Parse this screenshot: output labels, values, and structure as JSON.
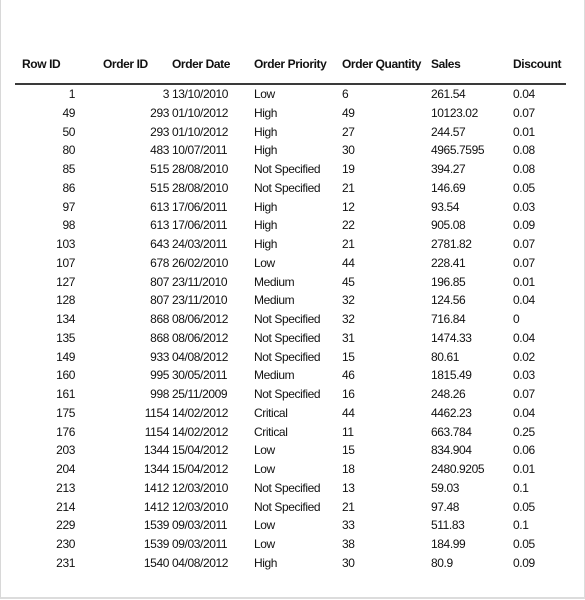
{
  "table": {
    "headers": {
      "row_id": "Row ID",
      "order_id": "Order ID",
      "order_date": "Order Date",
      "order_priority": "Order Priority",
      "order_quantity": "Order Quantity",
      "sales": "Sales",
      "discount": "Discount"
    },
    "rows": [
      {
        "row_id": "1",
        "order_id": "3",
        "order_date": "13/10/2010",
        "order_priority": "Low",
        "order_quantity": "6",
        "sales": "261.54",
        "discount": "0.04"
      },
      {
        "row_id": "49",
        "order_id": "293",
        "order_date": "01/10/2012",
        "order_priority": "High",
        "order_quantity": "49",
        "sales": "10123.02",
        "discount": "0.07"
      },
      {
        "row_id": "50",
        "order_id": "293",
        "order_date": "01/10/2012",
        "order_priority": "High",
        "order_quantity": "27",
        "sales": "244.57",
        "discount": "0.01"
      },
      {
        "row_id": "80",
        "order_id": "483",
        "order_date": "10/07/2011",
        "order_priority": "High",
        "order_quantity": "30",
        "sales": "4965.7595",
        "discount": "0.08"
      },
      {
        "row_id": "85",
        "order_id": "515",
        "order_date": "28/08/2010",
        "order_priority": "Not Specified",
        "order_quantity": "19",
        "sales": "394.27",
        "discount": "0.08"
      },
      {
        "row_id": "86",
        "order_id": "515",
        "order_date": "28/08/2010",
        "order_priority": "Not Specified",
        "order_quantity": "21",
        "sales": "146.69",
        "discount": "0.05"
      },
      {
        "row_id": "97",
        "order_id": "613",
        "order_date": "17/06/2011",
        "order_priority": "High",
        "order_quantity": "12",
        "sales": "93.54",
        "discount": "0.03"
      },
      {
        "row_id": "98",
        "order_id": "613",
        "order_date": "17/06/2011",
        "order_priority": "High",
        "order_quantity": "22",
        "sales": "905.08",
        "discount": "0.09"
      },
      {
        "row_id": "103",
        "order_id": "643",
        "order_date": "24/03/2011",
        "order_priority": "High",
        "order_quantity": "21",
        "sales": "2781.82",
        "discount": "0.07"
      },
      {
        "row_id": "107",
        "order_id": "678",
        "order_date": "26/02/2010",
        "order_priority": "Low",
        "order_quantity": "44",
        "sales": "228.41",
        "discount": "0.07"
      },
      {
        "row_id": "127",
        "order_id": "807",
        "order_date": "23/11/2010",
        "order_priority": "Medium",
        "order_quantity": "45",
        "sales": "196.85",
        "discount": "0.01"
      },
      {
        "row_id": "128",
        "order_id": "807",
        "order_date": "23/11/2010",
        "order_priority": "Medium",
        "order_quantity": "32",
        "sales": "124.56",
        "discount": "0.04"
      },
      {
        "row_id": "134",
        "order_id": "868",
        "order_date": "08/06/2012",
        "order_priority": "Not Specified",
        "order_quantity": "32",
        "sales": "716.84",
        "discount": "0"
      },
      {
        "row_id": "135",
        "order_id": "868",
        "order_date": "08/06/2012",
        "order_priority": "Not Specified",
        "order_quantity": "31",
        "sales": "1474.33",
        "discount": "0.04"
      },
      {
        "row_id": "149",
        "order_id": "933",
        "order_date": "04/08/2012",
        "order_priority": "Not Specified",
        "order_quantity": "15",
        "sales": "80.61",
        "discount": "0.02"
      },
      {
        "row_id": "160",
        "order_id": "995",
        "order_date": "30/05/2011",
        "order_priority": "Medium",
        "order_quantity": "46",
        "sales": "1815.49",
        "discount": "0.03"
      },
      {
        "row_id": "161",
        "order_id": "998",
        "order_date": "25/11/2009",
        "order_priority": "Not Specified",
        "order_quantity": "16",
        "sales": "248.26",
        "discount": "0.07"
      },
      {
        "row_id": "175",
        "order_id": "1154",
        "order_date": "14/02/2012",
        "order_priority": "Critical",
        "order_quantity": "44",
        "sales": "4462.23",
        "discount": "0.04"
      },
      {
        "row_id": "176",
        "order_id": "1154",
        "order_date": "14/02/2012",
        "order_priority": "Critical",
        "order_quantity": "11",
        "sales": "663.784",
        "discount": "0.25"
      },
      {
        "row_id": "203",
        "order_id": "1344",
        "order_date": "15/04/2012",
        "order_priority": "Low",
        "order_quantity": "15",
        "sales": "834.904",
        "discount": "0.06"
      },
      {
        "row_id": "204",
        "order_id": "1344",
        "order_date": "15/04/2012",
        "order_priority": "Low",
        "order_quantity": "18",
        "sales": "2480.9205",
        "discount": "0.01"
      },
      {
        "row_id": "213",
        "order_id": "1412",
        "order_date": "12/03/2010",
        "order_priority": "Not Specified",
        "order_quantity": "13",
        "sales": "59.03",
        "discount": "0.1"
      },
      {
        "row_id": "214",
        "order_id": "1412",
        "order_date": "12/03/2010",
        "order_priority": "Not Specified",
        "order_quantity": "21",
        "sales": "97.48",
        "discount": "0.05"
      },
      {
        "row_id": "229",
        "order_id": "1539",
        "order_date": "09/03/2011",
        "order_priority": "Low",
        "order_quantity": "33",
        "sales": "511.83",
        "discount": "0.1"
      },
      {
        "row_id": "230",
        "order_id": "1539",
        "order_date": "09/03/2011",
        "order_priority": "Low",
        "order_quantity": "38",
        "sales": "184.99",
        "discount": "0.05"
      },
      {
        "row_id": "231",
        "order_id": "1540",
        "order_date": "04/08/2012",
        "order_priority": "High",
        "order_quantity": "30",
        "sales": "80.9",
        "discount": "0.09"
      }
    ]
  }
}
